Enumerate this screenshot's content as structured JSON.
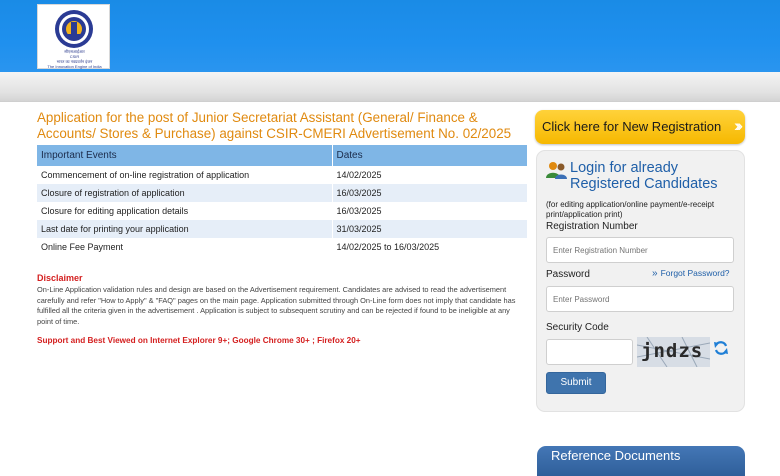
{
  "header": {
    "logo_text_line1": "सीएसआईआर",
    "logo_text_line2": "CSIR",
    "logo_text_line3": "भारत का नवप्रवर्तन इंजन",
    "logo_text_line4": "The Innovation Engine of India"
  },
  "main": {
    "title": "Application for the post of Junior Secretariat Assistant (General/ Finance & Accounts/ Stores & Purchase) against CSIR-CMERI Advertisement No. 02/2025",
    "table": {
      "headers": [
        "Important Events",
        "Dates"
      ],
      "rows": [
        [
          "Commencement of on-line registration of application",
          "14/02/2025"
        ],
        [
          "Closure of registration of application",
          "16/03/2025"
        ],
        [
          "Closure for editing application details",
          "16/03/2025"
        ],
        [
          "Last date for printing your application",
          "31/03/2025"
        ],
        [
          "Online Fee Payment",
          "14/02/2025 to 16/03/2025"
        ]
      ]
    },
    "disclaimer_title": "Disclaimer",
    "disclaimer_text": "On-Line Application validation rules and design are based on the Advertisement requirement. Candidates are advised to read the advertisement carefully and refer \"How to Apply\" & \"FAQ\" pages on the main page. Application submitted through On-Line form does not imply that candidate has fulfilled all the criteria given in the advertisement . Application is subject to subsequent scrutiny and can be rejected if found to be ineligible at any point of time.",
    "support_text": "Support and Best Viewed on Internet Explorer 9+; Google Chrome 30+ ; Firefox 20+"
  },
  "sidebar": {
    "new_registration_label": "Click here for New Registration",
    "login_title": "Login for already Registered Candidates",
    "login_note": "(for editing application/online payment/e-receipt print/application print)",
    "registration_label": "Registration Number",
    "registration_placeholder": "Enter Registration Number",
    "password_label": "Password",
    "password_placeholder": "Enter Password",
    "forgot_password": "Forgot Password?",
    "security_label": "Security Code",
    "captcha_text": "jndzs",
    "submit_label": "Submit",
    "reference_documents": "Reference Documents"
  },
  "colors": {
    "header_blue": "#1f90ee",
    "title_orange": "#e08a10",
    "link_blue": "#1f5fa8",
    "button_yellow": "#f6b800",
    "disclaimer_red": "#d42020"
  },
  "icons": [
    "csir-logo-icon",
    "chevron-double-right-icon",
    "users-icon",
    "double-chevron-icon",
    "refresh-icon"
  ]
}
